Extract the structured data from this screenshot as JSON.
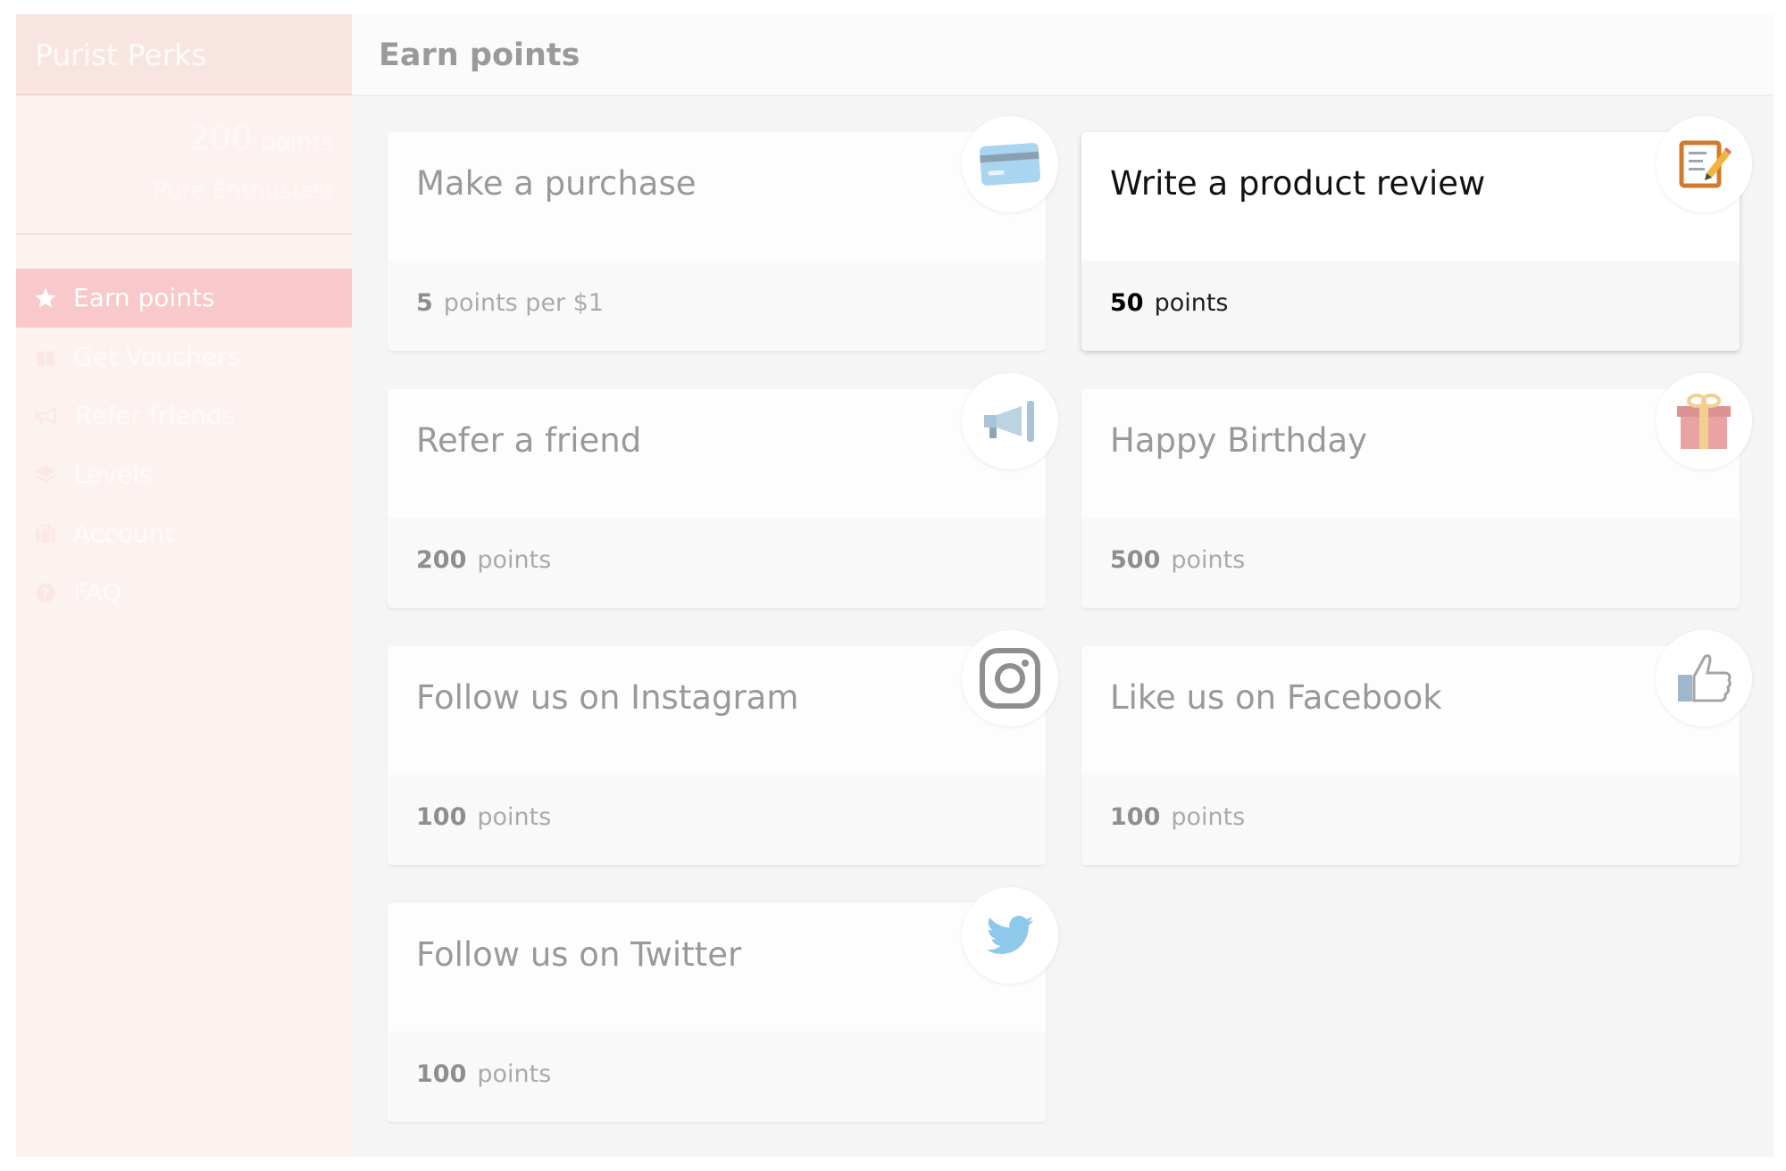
{
  "sidebar": {
    "brand": "Purist Perks",
    "points_value": "200",
    "points_unit": "points",
    "level_name": "Pure Enthusiast",
    "nav": [
      {
        "label": "Earn points",
        "icon": "star-icon",
        "active": true
      },
      {
        "label": "Get Vouchers",
        "icon": "gift-icon"
      },
      {
        "label": "Refer friends",
        "icon": "megaphone-icon"
      },
      {
        "label": "Levels",
        "icon": "layers-icon"
      },
      {
        "label": "Account",
        "icon": "suitcase-icon"
      },
      {
        "label": "FAQ",
        "icon": "question-icon"
      }
    ]
  },
  "main": {
    "title": "Earn points",
    "cards": [
      {
        "title": "Make a purchase",
        "points": "5",
        "unit": "points per $1",
        "icon": "credit-card-icon"
      },
      {
        "title": "Write a product review",
        "points": "50",
        "unit": "points",
        "icon": "review-notepad-icon",
        "highlighted": true
      },
      {
        "title": "Refer a friend",
        "points": "200",
        "unit": "points",
        "icon": "megaphone-icon"
      },
      {
        "title": "Happy Birthday",
        "points": "500",
        "unit": "points",
        "icon": "gift-box-icon"
      },
      {
        "title": "Follow us on Instagram",
        "points": "100",
        "unit": "points",
        "icon": "instagram-icon"
      },
      {
        "title": "Like us on Facebook",
        "points": "100",
        "unit": "points",
        "icon": "thumbs-up-icon"
      },
      {
        "title": "Follow us on Twitter",
        "points": "100",
        "unit": "points",
        "icon": "twitter-bird-icon"
      }
    ]
  },
  "colors": {
    "sidebar_bg": "#fcf2f0",
    "active_nav_bg": "#f8c8ca",
    "card_bg": "#fdfdfd",
    "card_twitter_blue": "#8ec9ec",
    "gift_red": "#e9a3a3"
  }
}
